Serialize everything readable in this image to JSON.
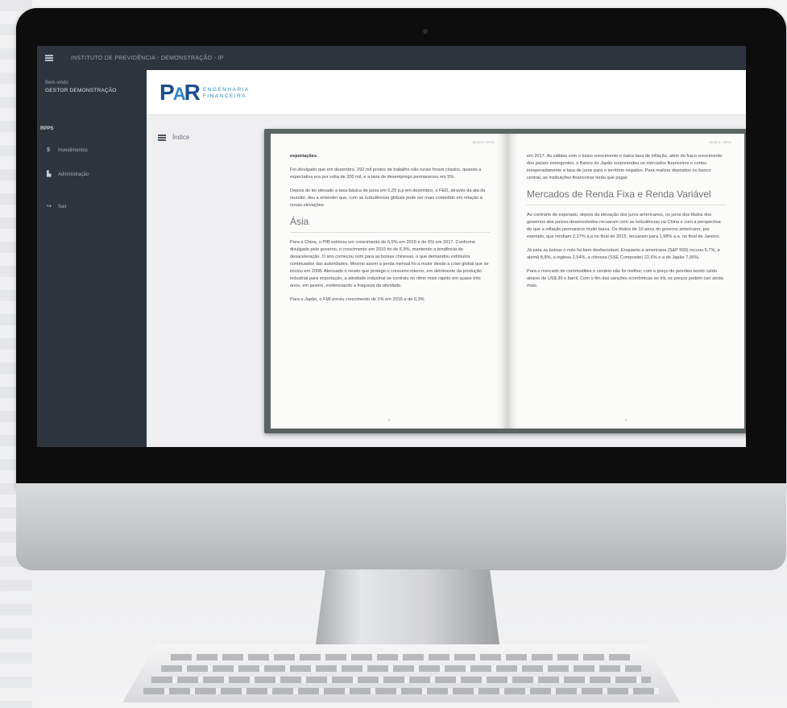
{
  "app": {
    "title": "INSTITUTO DE PREVIDÊNCIA - DEMONSTRAÇÃO - IP"
  },
  "sidebar": {
    "greeting": "Bem-vindo",
    "user": "GESTOR DEMONSTRAÇÃO",
    "section": "RPPS",
    "items": [
      {
        "label": "Investimentos",
        "icon": "dollar-icon"
      },
      {
        "label": "Administração",
        "icon": "chart-icon"
      },
      {
        "label": "Sair",
        "icon": "exit-icon"
      }
    ]
  },
  "brand": {
    "mark_p": "P",
    "mark_a": "A",
    "mark_r": "R",
    "line1": "ENGENHARIA",
    "line2": "FINANCEIRA",
    "color_dark": "#1c4e8c",
    "color_light": "#2f86c9"
  },
  "main": {
    "index_label": "Índice"
  },
  "book": {
    "left": {
      "header": "Janeiro / 2016",
      "lead": "exportações.",
      "p1": "Foi divulgado que em dezembro, 292 mil postos de trabalho não-rurais foram criados, quando a expectativa era por volta de 200 mil, e a taxa de desemprego permaneceu em 5%.",
      "p2": "Depois de ter elevado a taxa básica de juros em 0,25 p.p em dezembro, o FED, através da ata da reunião, deu a entender que, com as turbulências globais pode ser mais comedido em relação à novas elevações.",
      "heading": "Ásia",
      "p3": "Para a China, o PIB estimou um crescimento de 6,9% em 2015 e de 6% em 2017. Conforme divulgado pelo governo, o crescimento em 2015 foi de 6,9%, mantendo a tendência de desaceleração. O ano começou ruim para as bolsas chinesas, o que demandou estímulos continuados das autoridades. Mesmo assim a perda mensal foi a maior desde a crise global que se iniciou em 2008. Atenuado o receio que protege o consumo interno, em detrimento da produção industrial para exportação, a atividade industrial se contraiu no ritmo mais rápido em quase três anos, em janeiro, evidenciando a fraqueza da atividade.",
      "p4": "Para o Japão, o FMI previu crescimento de 1% em 2016 e de 0,3%",
      "page_num": "3"
    },
    "right": {
      "header": "Janeiro / 2016",
      "p1": "em 2017. As válidas com o baixo crescimento e baixa taxa de inflação, além do fraco crescimento dos países emergentes, o Banco do Japão surpreendeu os mercados financeiros e cortou inesperadamente a taxa de juros para o território negativo. Para realizar depósitos no banco central, as instituições financeiras terão que pagar.",
      "heading": "Mercados de Renda Fixa e Renda Variável",
      "p2": "Ao contrário do esperado, depois da elevação dos juros americanos, os juros dos títulos dos governos dos países desenvolvidos recuaram com as turbulências na China e com a perspectiva de que a inflação permanece muito baixa. Os títulos de 10 anos do governo americano, por exemplo, que rendiam 2,27% a.a no final de 2015, recuaram para 1,98% a.a. no final de Janeiro.",
      "p3": "Já para as bolsas o mês foi bem desfavorável. Enquanto a americana (S&P 500) recuou 5,7%, a alemã 8,8%, a inglesa 2,54%, a chinesa (SSE Composite) 22,6% e a do Japão 7,96%.",
      "p4": "Para o mercado de commodities o cenário não foi melhor, com o preço do petróleo tendo caído abaixo de US$ 30 o barril. Com o fim das sanções econômicas ao Irã, os preços podem cair ainda mais.",
      "page_num": "4"
    }
  }
}
